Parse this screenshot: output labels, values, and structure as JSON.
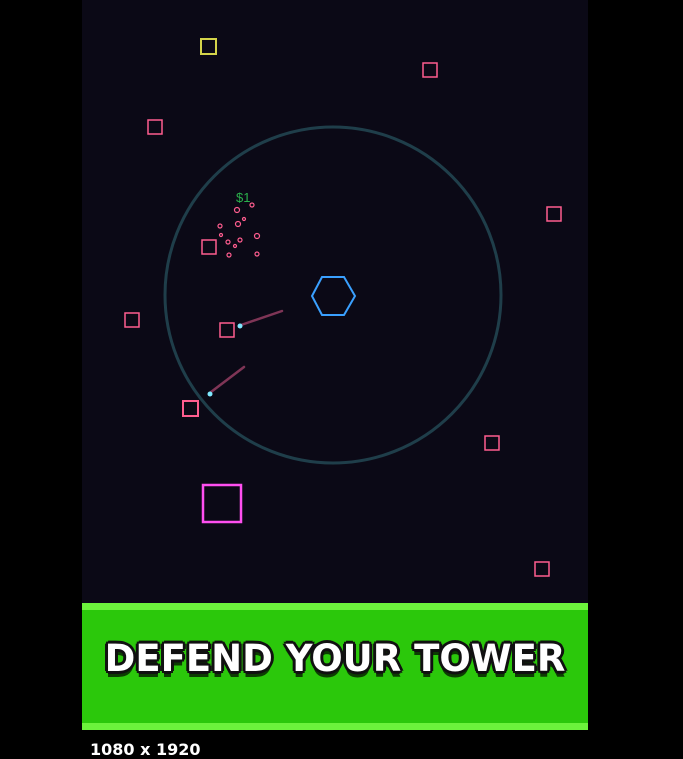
{
  "game": {
    "background": "#0b0916",
    "tower": {
      "shape": "hexagon",
      "color": "#3aa0ff"
    },
    "range_ring_color": "#1f3e4a",
    "money_popup": "$1",
    "money_color": "#2bb24c",
    "enemy_color": "#ff5d8f",
    "enemy_alt_color": "#d4d44a",
    "boss_color": "#ff4ff0",
    "bullet_color": "#7fe9ff"
  },
  "banner": {
    "text": "DEFEND YOUR TOWER",
    "background": "#2bc80b"
  },
  "footer": {
    "dimensions_text": "1080 x 1920"
  }
}
